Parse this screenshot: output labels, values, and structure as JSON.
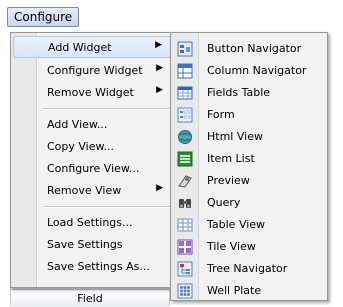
{
  "menubar": {
    "label": "Configure"
  },
  "menu": {
    "items": [
      {
        "label": "Add Widget",
        "submenu": true,
        "highlighted": true
      },
      {
        "label": "Configure Widget",
        "submenu": true
      },
      {
        "label": "Remove Widget",
        "submenu": true
      },
      {
        "label": "Add View..."
      },
      {
        "label": "Copy View..."
      },
      {
        "label": "Configure View..."
      },
      {
        "label": "Remove View",
        "submenu": true
      },
      {
        "label": "Load Settings..."
      },
      {
        "label": "Save Settings"
      },
      {
        "label": "Save Settings As..."
      }
    ]
  },
  "submenu": {
    "items": [
      {
        "label": "Button Navigator",
        "icon": "button-navigator-icon"
      },
      {
        "label": "Column Navigator",
        "icon": "column-navigator-icon"
      },
      {
        "label": "Fields Table",
        "icon": "fields-table-icon"
      },
      {
        "label": "Form",
        "icon": "form-icon"
      },
      {
        "label": "Html View",
        "icon": "html-view-icon"
      },
      {
        "label": "Item List",
        "icon": "item-list-icon"
      },
      {
        "label": "Preview",
        "icon": "preview-icon"
      },
      {
        "label": "Query",
        "icon": "query-icon"
      },
      {
        "label": "Table View",
        "icon": "table-view-icon"
      },
      {
        "label": "Tile View",
        "icon": "tile-view-icon"
      },
      {
        "label": "Tree Navigator",
        "icon": "tree-navigator-icon"
      },
      {
        "label": "Well Plate",
        "icon": "well-plate-icon"
      }
    ]
  },
  "background": {
    "field_header": "Field"
  },
  "colors": {
    "highlight_border": "#a9c8f0",
    "highlight_fill": "#dce9fb",
    "menu_bg": "#f2f2f2"
  }
}
